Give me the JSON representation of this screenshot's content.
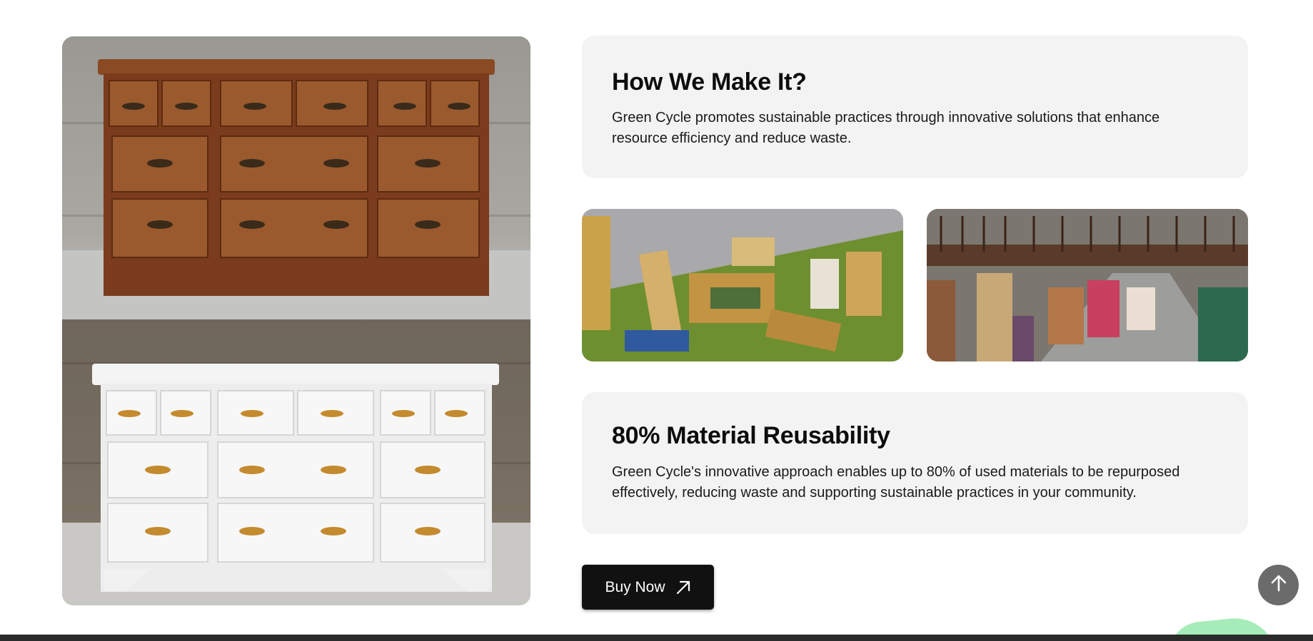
{
  "hero": {
    "image_icon": "dresser-before-after-image"
  },
  "section_1": {
    "title": "How We Make It?",
    "description": "Green Cycle promotes sustainable practices through innovative solutions that enhance resource efficiency and reduce waste."
  },
  "photos": [
    {
      "icon": "discarded-furniture-image"
    },
    {
      "icon": "furniture-warehouse-image"
    }
  ],
  "section_2": {
    "title": "80% Material Reusability",
    "description": "Green Cycle's innovative approach enables up to 80% of used materials to be repurposed effectively, reducing waste and supporting sustainable practices in your community."
  },
  "cta": {
    "buy_label": "Buy Now",
    "icon": "arrow-up-right-icon"
  },
  "scroll_top": {
    "icon": "arrow-up-icon"
  },
  "colors": {
    "card_bg": "#f3f3f3",
    "button_bg": "#111111",
    "scroll_button_bg": "#6b6b6b",
    "accent_green": "#a6ecb8",
    "footer_bg": "#2b2b2b"
  }
}
